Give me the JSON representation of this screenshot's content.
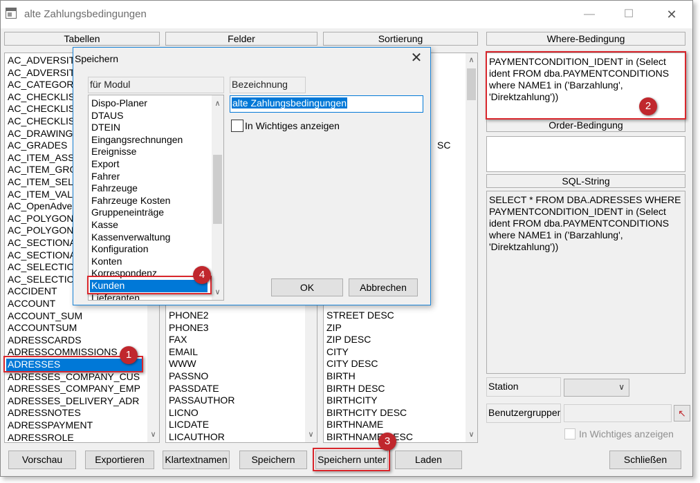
{
  "window": {
    "title": "alte Zahlungsbedingungen",
    "minimize_glyph": "—",
    "maximize_glyph": "☐",
    "close_glyph": "✕"
  },
  "columns": {
    "tabellen": "Tabellen",
    "felder": "Felder",
    "sortierung": "Sortierung",
    "where": "Where-Bedingung",
    "order": "Order-Bedingung",
    "sql": "SQL-String"
  },
  "tabellen_items": [
    "AC_ADVERSIT",
    "AC_ADVERSIT",
    "AC_CATEGOR",
    "AC_CHECKLIS",
    "AC_CHECKLIS",
    "AC_CHECKLIS",
    "AC_DRAWING",
    "AC_GRADES",
    "AC_ITEM_ASS",
    "AC_ITEM_GRO",
    "AC_ITEM_SEL",
    "AC_ITEM_VAL",
    "AC_OpenAdver",
    "AC_POLYGON",
    "AC_POLYGON",
    "AC_SECTIONA",
    "AC_SECTIONA",
    "AC_SELECTIO",
    "AC_SELECTIO",
    "ACCIDENT",
    "ACCOUNT",
    "ACCOUNT_SUM",
    "ACCOUNTSUM",
    "ADRESSCARDS",
    "ADRESSCOMMISSIONS",
    "ADRESSES",
    "ADRESSES_COMPANY_CUS",
    "ADRESSES_COMPANY_EMP",
    "ADRESSES_DELIVERY_ADR",
    "ADRESSNOTES",
    "ADRESSPAYMENT",
    "ADRESSROLE"
  ],
  "tabellen_selected_index": 25,
  "felder_items": [
    "PHONE2",
    "PHONE3",
    "FAX",
    "EMAIL",
    "WWW",
    "PASSNO",
    "PASSDATE",
    "PASSAUTHOR",
    "LICNO",
    "LICDATE",
    "LICAUTHOR"
  ],
  "sortierung_fragment": "SC",
  "sortierung_items": [
    "STREET DESC",
    "ZIP",
    "ZIP DESC",
    "CITY",
    "CITY DESC",
    "BIRTH",
    "BIRTH DESC",
    "BIRTHCITY",
    "BIRTHCITY DESC",
    "BIRTHNAME",
    "BIRTHNAME DESC"
  ],
  "where_text": "PAYMENTCONDITION_IDENT in (Select ident FROM dba.PAYMENTCONDITIONS where NAME1 in ('Barzahlung', 'Direktzahlung'))",
  "order_text": "",
  "sql_text": "SELECT * FROM DBA.ADRESSES WHERE PAYMENTCONDITION_IDENT in (Select ident FROM dba.PAYMENTCONDITIONS where NAME1 in ('Barzahlung', 'Direktzahlung'))",
  "station": {
    "label": "Station",
    "value": ""
  },
  "benutzergruppen": {
    "label": "Benutzergruppen",
    "value": ""
  },
  "wichtiges_main": {
    "label": "In Wichtiges anzeigen",
    "checked": false,
    "enabled": false
  },
  "buttons": {
    "vorschau": "Vorschau",
    "exportieren": "Exportieren",
    "klartextnamen": "Klartextnamen",
    "speichern": "Speichern",
    "speichern_unter": "Speichern unter",
    "laden": "Laden",
    "schliessen": "Schließen"
  },
  "dialog": {
    "title": "Speichern",
    "close_glyph": "✕",
    "modul_header": "für Modul",
    "bezeichnung_header": "Bezeichnung",
    "bezeichnung_value": "alte Zahlungsbedingungen",
    "wichtiges_label": "In Wichtiges anzeigen",
    "wichtiges_checked": false,
    "modules": [
      "Dispo-Planer",
      "DTAUS",
      "DTEIN",
      "Eingangsrechnungen",
      "Ereignisse",
      "Export",
      "Fahrer",
      "Fahrzeuge",
      "Fahrzeuge Kosten",
      "Gruppeneinträge",
      "Kasse",
      "Kassenverwaltung",
      "Konfiguration",
      "Konten",
      "Korrespondenz",
      "Kunden",
      "Lieferanten"
    ],
    "selected_module_index": 15,
    "ok": "OK",
    "abbrechen": "Abbrechen"
  },
  "callouts": [
    "1",
    "2",
    "3",
    "4"
  ],
  "colors": {
    "selection": "#0078d7",
    "callout": "#c0272d",
    "highlight_border": "#d9262c"
  }
}
